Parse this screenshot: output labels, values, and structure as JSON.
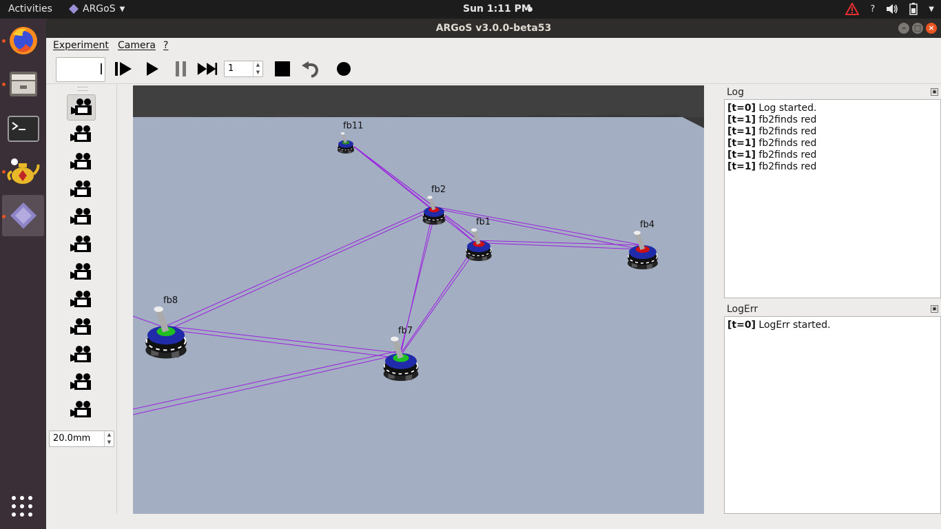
{
  "topbar": {
    "activities": "Activities",
    "app_name": "ARGoS",
    "clock": "Sun  1:11 PM",
    "help": "?",
    "icons": [
      "warning-icon",
      "volume-icon",
      "battery-icon",
      "system-menu-icon"
    ]
  },
  "dock": {
    "items": [
      "firefox-icon",
      "files-icon",
      "terminal-icon",
      "teapot-icon",
      "argos-icon"
    ],
    "apps_grid": "show-apps-icon"
  },
  "window": {
    "title": "ARGoS v3.0.0-beta53"
  },
  "menu": {
    "items": [
      "Experiment",
      "Camera",
      "?"
    ]
  },
  "toolbar": {
    "step_value": "1",
    "buttons": [
      "step-icon",
      "play-icon",
      "pause-icon",
      "fast-forward-icon",
      "stop-icon",
      "reset-icon",
      "record-icon"
    ]
  },
  "camera_panel": {
    "camera_count": 12,
    "focal_length": "20.0mm"
  },
  "scene": {
    "robots": [
      {
        "label": "fb11",
        "led": "#2a8a2a"
      },
      {
        "label": "fb2",
        "led": "#d01010"
      },
      {
        "label": "fb1",
        "led": "#d01010"
      },
      {
        "label": "fb4",
        "led": "#d01010"
      },
      {
        "label": "fb8",
        "led": "#20c020"
      },
      {
        "label": "fb7",
        "led": "#20c020"
      }
    ],
    "ray_color": "#9b1fe0",
    "floor_color": "#a3aec3",
    "wall_color": "#404040"
  },
  "log": {
    "title": "Log",
    "lines": [
      {
        "t": "[t=0]",
        "msg": " Log started."
      },
      {
        "t": "[t=1]",
        "msg": " fb2finds red"
      },
      {
        "t": "[t=1]",
        "msg": " fb2finds red"
      },
      {
        "t": "[t=1]",
        "msg": " fb2finds red"
      },
      {
        "t": "[t=1]",
        "msg": " fb2finds red"
      },
      {
        "t": "[t=1]",
        "msg": " fb2finds red"
      }
    ]
  },
  "logerr": {
    "title": "LogErr",
    "lines": [
      {
        "t": "[t=0]",
        "msg": " LogErr started."
      }
    ]
  }
}
